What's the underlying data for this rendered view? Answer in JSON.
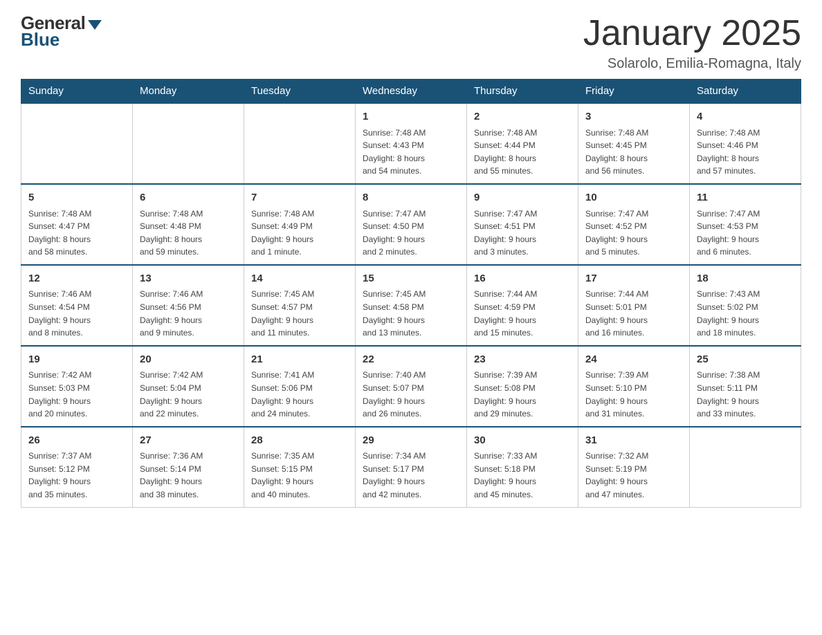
{
  "logo": {
    "general": "General",
    "blue": "Blue"
  },
  "title": "January 2025",
  "location": "Solarolo, Emilia-Romagna, Italy",
  "days_of_week": [
    "Sunday",
    "Monday",
    "Tuesday",
    "Wednesday",
    "Thursday",
    "Friday",
    "Saturday"
  ],
  "weeks": [
    [
      {
        "day": "",
        "info": ""
      },
      {
        "day": "",
        "info": ""
      },
      {
        "day": "",
        "info": ""
      },
      {
        "day": "1",
        "info": "Sunrise: 7:48 AM\nSunset: 4:43 PM\nDaylight: 8 hours\nand 54 minutes."
      },
      {
        "day": "2",
        "info": "Sunrise: 7:48 AM\nSunset: 4:44 PM\nDaylight: 8 hours\nand 55 minutes."
      },
      {
        "day": "3",
        "info": "Sunrise: 7:48 AM\nSunset: 4:45 PM\nDaylight: 8 hours\nand 56 minutes."
      },
      {
        "day": "4",
        "info": "Sunrise: 7:48 AM\nSunset: 4:46 PM\nDaylight: 8 hours\nand 57 minutes."
      }
    ],
    [
      {
        "day": "5",
        "info": "Sunrise: 7:48 AM\nSunset: 4:47 PM\nDaylight: 8 hours\nand 58 minutes."
      },
      {
        "day": "6",
        "info": "Sunrise: 7:48 AM\nSunset: 4:48 PM\nDaylight: 8 hours\nand 59 minutes."
      },
      {
        "day": "7",
        "info": "Sunrise: 7:48 AM\nSunset: 4:49 PM\nDaylight: 9 hours\nand 1 minute."
      },
      {
        "day": "8",
        "info": "Sunrise: 7:47 AM\nSunset: 4:50 PM\nDaylight: 9 hours\nand 2 minutes."
      },
      {
        "day": "9",
        "info": "Sunrise: 7:47 AM\nSunset: 4:51 PM\nDaylight: 9 hours\nand 3 minutes."
      },
      {
        "day": "10",
        "info": "Sunrise: 7:47 AM\nSunset: 4:52 PM\nDaylight: 9 hours\nand 5 minutes."
      },
      {
        "day": "11",
        "info": "Sunrise: 7:47 AM\nSunset: 4:53 PM\nDaylight: 9 hours\nand 6 minutes."
      }
    ],
    [
      {
        "day": "12",
        "info": "Sunrise: 7:46 AM\nSunset: 4:54 PM\nDaylight: 9 hours\nand 8 minutes."
      },
      {
        "day": "13",
        "info": "Sunrise: 7:46 AM\nSunset: 4:56 PM\nDaylight: 9 hours\nand 9 minutes."
      },
      {
        "day": "14",
        "info": "Sunrise: 7:45 AM\nSunset: 4:57 PM\nDaylight: 9 hours\nand 11 minutes."
      },
      {
        "day": "15",
        "info": "Sunrise: 7:45 AM\nSunset: 4:58 PM\nDaylight: 9 hours\nand 13 minutes."
      },
      {
        "day": "16",
        "info": "Sunrise: 7:44 AM\nSunset: 4:59 PM\nDaylight: 9 hours\nand 15 minutes."
      },
      {
        "day": "17",
        "info": "Sunrise: 7:44 AM\nSunset: 5:01 PM\nDaylight: 9 hours\nand 16 minutes."
      },
      {
        "day": "18",
        "info": "Sunrise: 7:43 AM\nSunset: 5:02 PM\nDaylight: 9 hours\nand 18 minutes."
      }
    ],
    [
      {
        "day": "19",
        "info": "Sunrise: 7:42 AM\nSunset: 5:03 PM\nDaylight: 9 hours\nand 20 minutes."
      },
      {
        "day": "20",
        "info": "Sunrise: 7:42 AM\nSunset: 5:04 PM\nDaylight: 9 hours\nand 22 minutes."
      },
      {
        "day": "21",
        "info": "Sunrise: 7:41 AM\nSunset: 5:06 PM\nDaylight: 9 hours\nand 24 minutes."
      },
      {
        "day": "22",
        "info": "Sunrise: 7:40 AM\nSunset: 5:07 PM\nDaylight: 9 hours\nand 26 minutes."
      },
      {
        "day": "23",
        "info": "Sunrise: 7:39 AM\nSunset: 5:08 PM\nDaylight: 9 hours\nand 29 minutes."
      },
      {
        "day": "24",
        "info": "Sunrise: 7:39 AM\nSunset: 5:10 PM\nDaylight: 9 hours\nand 31 minutes."
      },
      {
        "day": "25",
        "info": "Sunrise: 7:38 AM\nSunset: 5:11 PM\nDaylight: 9 hours\nand 33 minutes."
      }
    ],
    [
      {
        "day": "26",
        "info": "Sunrise: 7:37 AM\nSunset: 5:12 PM\nDaylight: 9 hours\nand 35 minutes."
      },
      {
        "day": "27",
        "info": "Sunrise: 7:36 AM\nSunset: 5:14 PM\nDaylight: 9 hours\nand 38 minutes."
      },
      {
        "day": "28",
        "info": "Sunrise: 7:35 AM\nSunset: 5:15 PM\nDaylight: 9 hours\nand 40 minutes."
      },
      {
        "day": "29",
        "info": "Sunrise: 7:34 AM\nSunset: 5:17 PM\nDaylight: 9 hours\nand 42 minutes."
      },
      {
        "day": "30",
        "info": "Sunrise: 7:33 AM\nSunset: 5:18 PM\nDaylight: 9 hours\nand 45 minutes."
      },
      {
        "day": "31",
        "info": "Sunrise: 7:32 AM\nSunset: 5:19 PM\nDaylight: 9 hours\nand 47 minutes."
      },
      {
        "day": "",
        "info": ""
      }
    ]
  ]
}
